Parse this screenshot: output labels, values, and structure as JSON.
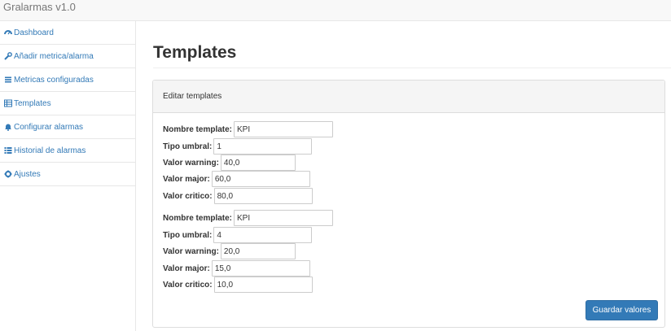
{
  "app": {
    "title": "Gralarmas v1.0"
  },
  "sidebar": {
    "items": [
      {
        "label": "Dashboard",
        "icon": "dashboard-icon"
      },
      {
        "label": "Añadir metrica/alarma",
        "icon": "wrench-icon"
      },
      {
        "label": "Metricas configuradas",
        "icon": "list-icon"
      },
      {
        "label": "Templates",
        "icon": "table-icon"
      },
      {
        "label": "Configurar alarmas",
        "icon": "bell-icon"
      },
      {
        "label": "Historial de alarmas",
        "icon": "history-list-icon"
      },
      {
        "label": "Ajustes",
        "icon": "gear-icon"
      }
    ]
  },
  "page": {
    "title": "Templates"
  },
  "panel": {
    "heading": "Editar templates",
    "templates": [
      {
        "nombre_label": "Nombre template:",
        "nombre": "KPI",
        "tipo_label": "Tipo umbral:",
        "tipo": "1",
        "warning_label": "Valor warning:",
        "warning": "40,0",
        "major_label": "Valor major:",
        "major": "60,0",
        "critico_label": "Valor critico:",
        "critico": "80,0"
      },
      {
        "nombre_label": "Nombre template:",
        "nombre": "KPI",
        "tipo_label": "Tipo umbral:",
        "tipo": "4",
        "warning_label": "Valor warning:",
        "warning": "20,0",
        "major_label": "Valor major:",
        "major": "15,0",
        "critico_label": "Valor critico:",
        "critico": "10,0"
      }
    ],
    "save_label": "Guardar valores"
  },
  "colors": {
    "link": "#337ab7",
    "primary": "#337ab7"
  }
}
